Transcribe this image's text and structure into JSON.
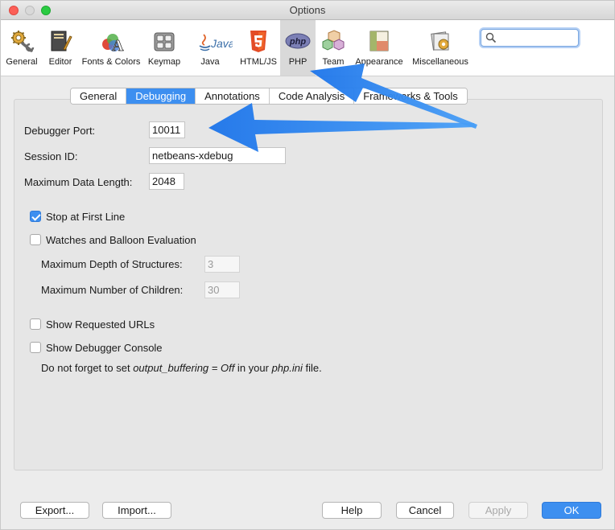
{
  "window": {
    "title": "Options"
  },
  "toolbar": {
    "items": [
      {
        "label": "General",
        "icon": "gear-icon"
      },
      {
        "label": "Editor",
        "icon": "editor-icon"
      },
      {
        "label": "Fonts & Colors",
        "icon": "fonts-colors-icon"
      },
      {
        "label": "Keymap",
        "icon": "keymap-icon"
      },
      {
        "label": "Java",
        "icon": "java-icon"
      },
      {
        "label": "HTML/JS",
        "icon": "html5-icon"
      },
      {
        "label": "PHP",
        "icon": "php-icon"
      },
      {
        "label": "Team",
        "icon": "team-icon"
      },
      {
        "label": "Appearance",
        "icon": "appearance-icon"
      },
      {
        "label": "Miscellaneous",
        "icon": "miscellaneous-icon"
      }
    ],
    "selected": "PHP",
    "search": {
      "value": "",
      "placeholder": ""
    }
  },
  "tabs": [
    "General",
    "Debugging",
    "Annotations",
    "Code Analysis",
    "Frameworks & Tools"
  ],
  "active_tab": "Debugging",
  "debugging": {
    "debugger_port_label": "Debugger Port:",
    "debugger_port_value": "10011",
    "session_id_label": "Session ID:",
    "session_id_value": "netbeans-xdebug",
    "max_data_length_label": "Maximum Data Length:",
    "max_data_length_value": "2048",
    "stop_first_line_label": "Stop at First Line",
    "stop_first_line_checked": true,
    "watches_label": "Watches and Balloon Evaluation",
    "watches_checked": false,
    "max_depth_label": "Maximum Depth of Structures:",
    "max_depth_value": "3",
    "max_children_label": "Maximum Number of Children:",
    "max_children_value": "30",
    "show_urls_label": "Show Requested URLs",
    "show_urls_checked": false,
    "show_console_label": "Show Debugger Console",
    "show_console_checked": false,
    "note_prefix": "Do not forget to set ",
    "note_setting": "output_buffering = Off",
    "note_middle": " in your ",
    "note_file": "php.ini",
    "note_suffix": " file."
  },
  "buttons": {
    "export": "Export...",
    "import": "Import...",
    "help": "Help",
    "cancel": "Cancel",
    "apply": "Apply",
    "ok": "OK"
  },
  "colors": {
    "accent": "#3d8ff0",
    "annotation_arrow": "#2b86f0"
  }
}
